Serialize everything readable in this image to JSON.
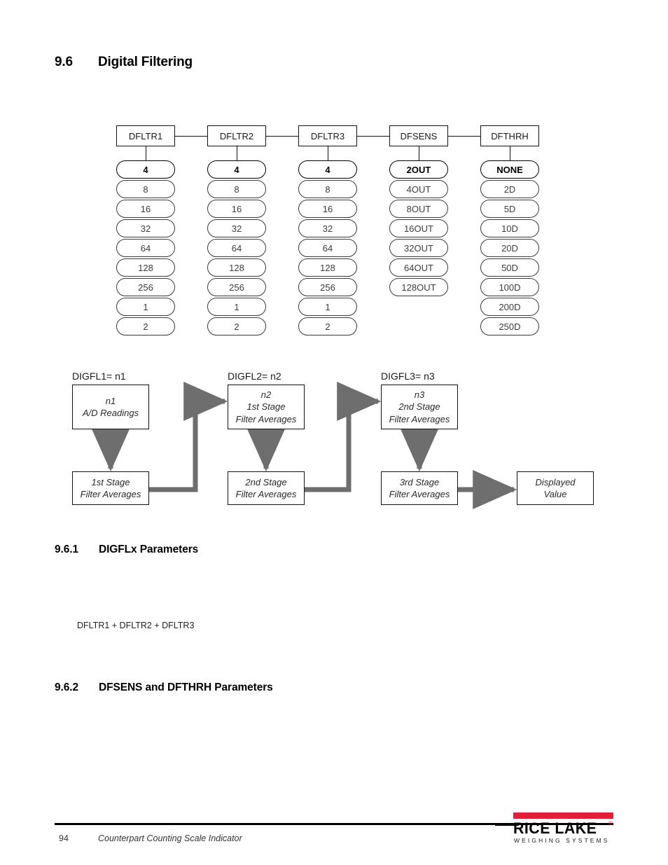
{
  "section": {
    "number": "9.6",
    "title": "Digital Filtering"
  },
  "menu_chart": {
    "columns": [
      {
        "header": "DFLTR1",
        "options": [
          "4",
          "8",
          "16",
          "32",
          "64",
          "128",
          "256",
          "1",
          "2"
        ]
      },
      {
        "header": "DFLTR2",
        "options": [
          "4",
          "8",
          "16",
          "32",
          "64",
          "128",
          "256",
          "1",
          "2"
        ]
      },
      {
        "header": "DFLTR3",
        "options": [
          "4",
          "8",
          "16",
          "32",
          "64",
          "128",
          "256",
          "1",
          "2"
        ]
      },
      {
        "header": "DFSENS",
        "options": [
          "2OUT",
          "4OUT",
          "8OUT",
          "16OUT",
          "32OUT",
          "64OUT",
          "128OUT"
        ]
      },
      {
        "header": "DFTHRH",
        "options": [
          "NONE",
          "2D",
          "5D",
          "10D",
          "20D",
          "50D",
          "100D",
          "200D",
          "250D"
        ]
      }
    ]
  },
  "stage_diagram": {
    "labels": [
      "DIGFL1= n1",
      "DIGFL2= n2",
      "DIGFL3= n3"
    ],
    "input_boxes": [
      {
        "line1": "n1",
        "line2": "A/D Readings"
      },
      {
        "line1": "n2",
        "line2": "1st Stage",
        "line3": "Filter Averages"
      },
      {
        "line1": "n3",
        "line2": "2nd Stage",
        "line3": "Filter Averages"
      }
    ],
    "output_boxes": [
      {
        "line1": "1st Stage",
        "line2": "Filter Averages"
      },
      {
        "line1": "2nd Stage",
        "line2": "Filter Averages"
      },
      {
        "line1": "3rd Stage",
        "line2": "Filter Averages"
      }
    ],
    "final_box": {
      "line1": "Displayed",
      "line2": "Value"
    },
    "connector_color": "#6E6E6E"
  },
  "subsection_1": {
    "number": "9.6.1",
    "title": "DIGFLx Parameters",
    "formula": "DFLTR1 + DFLTR2 + DFLTR3"
  },
  "subsection_2": {
    "number": "9.6.2",
    "title": "DFSENS and DFTHRH Parameters"
  },
  "footer": {
    "page_number": "94",
    "document_title": "Counterpart Counting Scale Indicator"
  },
  "logo": {
    "name": "RICE LAKE",
    "registered": "®",
    "tagline": "WEIGHING SYSTEMS",
    "accent_color": "#E21F38"
  }
}
